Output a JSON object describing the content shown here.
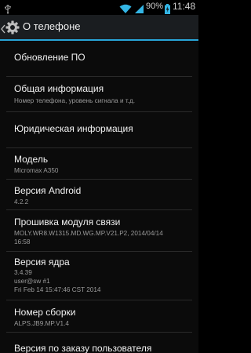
{
  "status_bar": {
    "usb_icon": "usb-icon",
    "wifi_icon": "wifi-icon",
    "signal_icon": "signal-icon",
    "battery_percent": "90%",
    "battery_icon": "battery-charging-icon",
    "time": "11:48"
  },
  "action_bar": {
    "title": "О телефоне",
    "accent_color": "#28a5d8"
  },
  "items": [
    {
      "title": "Обновление ПО"
    },
    {
      "title": "Общая информация",
      "subtitle": "Номер телефона, уровень сигнала и т.д."
    },
    {
      "title": "Юридическая информация"
    },
    {
      "title": "Модель",
      "subtitle": "Micromax A350"
    },
    {
      "title": "Версия Android",
      "subtitle": "4.2.2"
    },
    {
      "title": "Прошивка модуля связи",
      "subtitle_lines": [
        "MOLY.WR8.W1315.MD.WG.MP.V21.P2, 2014/04/14",
        "16:58"
      ]
    },
    {
      "title": "Версия ядра",
      "subtitle_lines": [
        "3.4.39",
        "user@sw #1",
        "Fri Feb 14 15:47:46 CST 2014"
      ]
    },
    {
      "title": "Номер сборки",
      "subtitle": "ALPS.JB9.MP.V1.4"
    },
    {
      "title": "Версия по заказу пользователя"
    }
  ]
}
